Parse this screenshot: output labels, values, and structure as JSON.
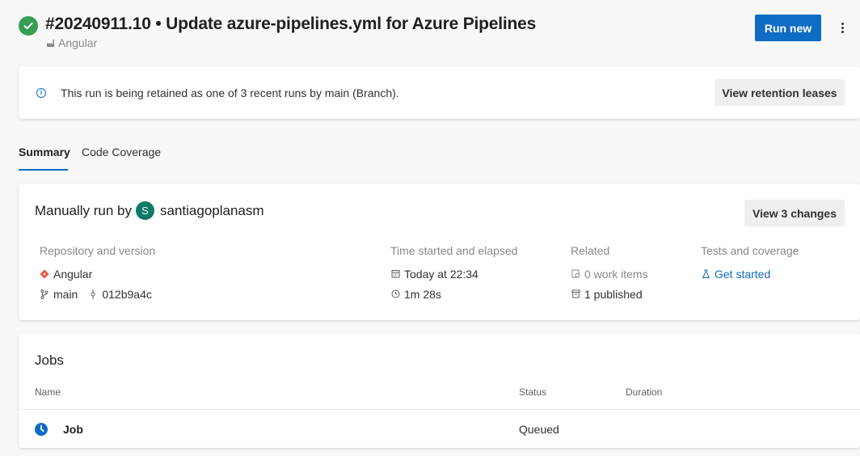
{
  "header": {
    "run_title": "#20240911.10 • Update azure-pipelines.yml for Azure Pipelines",
    "pipeline_name": "Angular",
    "run_new_label": "Run new",
    "status_color": "#359e52",
    "accent_color": "#0f6cc4"
  },
  "banner": {
    "message": "This run is being retained as one of 3 recent runs by main (Branch).",
    "button_label": "View retention leases",
    "icon": "info-icon"
  },
  "tabs": [
    {
      "label": "Summary",
      "selected": true
    },
    {
      "label": "Code Coverage",
      "selected": false
    }
  ],
  "summary": {
    "run_by_prefix": "Manually run by",
    "user_initial": "S",
    "user_name": "santiagoplanasm",
    "changes_button": "View 3 changes",
    "repo": {
      "heading": "Repository and version",
      "name": "Angular",
      "branch": "main",
      "commit": "012b9a4c"
    },
    "time": {
      "heading": "Time started and elapsed",
      "started": "Today at 22:34",
      "elapsed": "1m 28s"
    },
    "related": {
      "heading": "Related",
      "work_items": "0 work items",
      "published": "1 published"
    },
    "tests": {
      "heading": "Tests and coverage",
      "link": "Get started"
    }
  },
  "jobs": {
    "title": "Jobs",
    "columns": [
      "Name",
      "Status",
      "Duration"
    ],
    "rows": [
      {
        "name": "Job",
        "status": "Queued",
        "duration": ""
      }
    ]
  }
}
